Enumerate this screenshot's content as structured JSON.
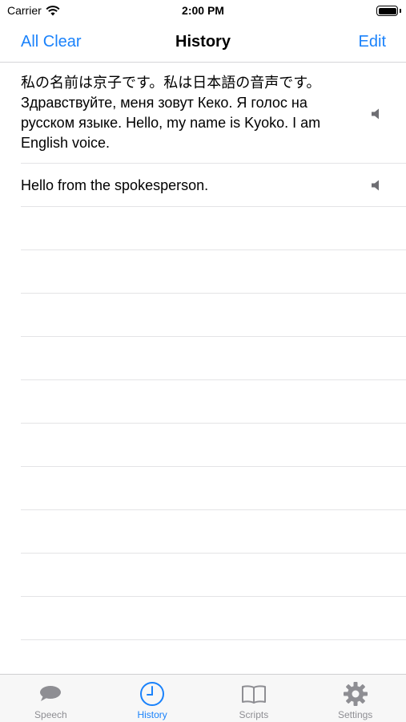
{
  "status_bar": {
    "carrier": "Carrier",
    "time": "2:00 PM"
  },
  "nav": {
    "left_action": "All Clear",
    "title": "History",
    "right_action": "Edit"
  },
  "history": {
    "items": [
      {
        "text": "私の名前は京子です。私は日本語の音声です。 Здравствуйте, меня зовут Кеко. Я голос на русском языке. Hello, my name is Kyoko. I am English voice.",
        "icon": "speaker-icon"
      },
      {
        "text": "Hello from the spokesperson.",
        "icon": "speaker-icon"
      }
    ]
  },
  "tab_bar": {
    "tabs": [
      {
        "label": "Speech",
        "icon": "speech-bubble-icon",
        "active": false
      },
      {
        "label": "History",
        "icon": "clock-icon",
        "active": true
      },
      {
        "label": "Scripts",
        "icon": "book-icon",
        "active": false
      },
      {
        "label": "Settings",
        "icon": "gear-icon",
        "active": false
      }
    ]
  },
  "colors": {
    "accent": "#1a82fb",
    "inactive": "#8e8e93",
    "separator": "#e4e4e6"
  }
}
